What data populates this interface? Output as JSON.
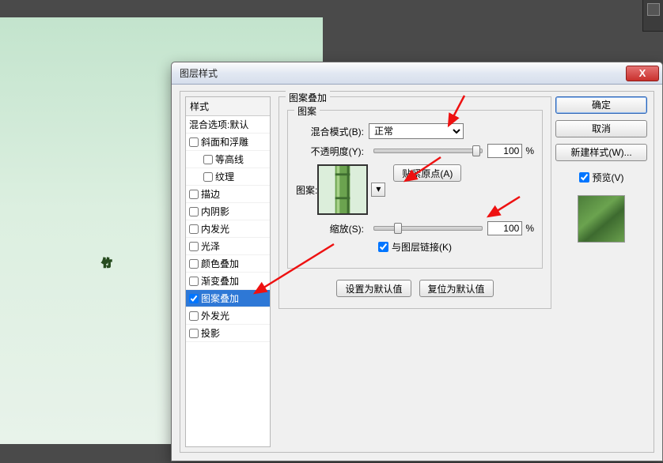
{
  "canvas": {
    "character": "竹"
  },
  "toolstrip": {
    "icon": "tonal-separation-icon"
  },
  "dialog": {
    "title": "图层样式",
    "close": "X",
    "styles_header": "样式",
    "blend_default": "混合选项:默认",
    "styles": [
      {
        "label": "斜面和浮雕",
        "checked": false
      },
      {
        "label": "等高线",
        "checked": false,
        "indent": true
      },
      {
        "label": "纹理",
        "checked": false,
        "indent": true
      },
      {
        "label": "描边",
        "checked": false
      },
      {
        "label": "内阴影",
        "checked": false
      },
      {
        "label": "内发光",
        "checked": false
      },
      {
        "label": "光泽",
        "checked": false
      },
      {
        "label": "颜色叠加",
        "checked": false
      },
      {
        "label": "渐变叠加",
        "checked": false
      },
      {
        "label": "图案叠加",
        "checked": true,
        "selected": true
      },
      {
        "label": "外发光",
        "checked": false
      },
      {
        "label": "投影",
        "checked": false
      }
    ],
    "panel": {
      "group_title": "图案叠加",
      "inner_title": "图案",
      "blend_mode_label": "混合模式(B):",
      "blend_mode_value": "正常",
      "opacity_label": "不透明度(Y):",
      "opacity_value": "100",
      "percent": "%",
      "pattern_label": "图案:",
      "snap_origin": "贴紧原点(A)",
      "scale_label": "缩放(S):",
      "scale_value": "100",
      "link_label": "与图层链接(K)",
      "link_checked": true,
      "set_default": "设置为默认值",
      "reset_default": "复位为默认值"
    },
    "buttons": {
      "ok": "确定",
      "cancel": "取消",
      "new_style": "新建样式(W)...",
      "preview": "预览(V)",
      "preview_checked": true
    }
  }
}
